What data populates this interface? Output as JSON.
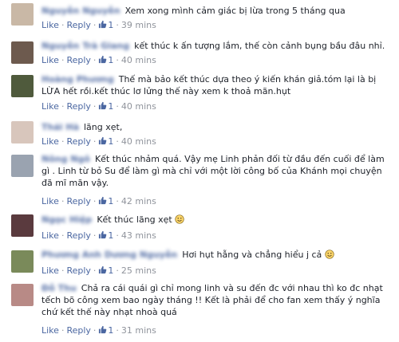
{
  "actions": {
    "like_label": "Like",
    "reply_label": "Reply",
    "separator": "·"
  },
  "comments": [
    {
      "name": "Nguyễn Nguyễn",
      "lines": [
        "Xem xong mình cảm giác bị lừa trong 5 tháng qua"
      ],
      "likes": "1",
      "time": "39 mins",
      "avatar_color": "#c9b8a6",
      "emoji": ""
    },
    {
      "name": "Nguyễn Trà Giang",
      "lines": [
        "kết thúc k ấn tượng lắm, thế còn cảnh bụng bầu đâu nhỉ."
      ],
      "likes": "1",
      "time": "40 mins",
      "avatar_color": "#6d5a4e",
      "emoji": ""
    },
    {
      "name": "Hoàng Phương",
      "lines": [
        "Thế mà bảo kết thúc dựa theo ý kiến khán giả.tóm lại là bị",
        "LỪA hết rồi.kết thúc lơ lửng thế này xem k thoả mãn.hụt"
      ],
      "likes": "1",
      "time": "40 mins",
      "avatar_color": "#4f5a3c",
      "emoji": ""
    },
    {
      "name": "Thái Hà",
      "lines": [
        "lãng xẹt,"
      ],
      "likes": "1",
      "time": "40 mins",
      "avatar_color": "#d8c6bc",
      "emoji": ""
    },
    {
      "name": "Nông Ngô",
      "lines": [
        "Kết thúc nhảm quá. Vậy mẹ Linh phản đối từ đầu đến cuối để làm",
        "gì . Linh từ bỏ Su để làm gì mà chỉ với một lời công bố của Khánh mọi chuyện",
        "đã mĩ mãn vậy."
      ],
      "likes": "1",
      "time": "42 mins",
      "avatar_color": "#9aa3b0",
      "emoji": ""
    },
    {
      "name": "Ngọc Hiệp",
      "lines": [
        "Kết thúc lãng xẹt"
      ],
      "likes": "1",
      "time": "43 mins",
      "avatar_color": "#5a3a3e",
      "emoji": "smile"
    },
    {
      "name": "Phương Anh Dương Nguyễn",
      "lines": [
        "Hơi hụt hẫng và chẳng hiểu j cả"
      ],
      "likes": "1",
      "time": "25 mins",
      "avatar_color": "#7a8a5a",
      "emoji": "smile"
    },
    {
      "name": "Đỗ Thu",
      "lines": [
        "Chả ra cái quái gì chỉ mong linh và su đến đc với nhau thì ko đc nhạt",
        "tếch bõ công xem bao ngày tháng !! Kết là phải để cho fan xem thấy ý nghĩa",
        "chứ kết thế này nhạt nhoà quá"
      ],
      "likes": "1",
      "time": "31 mins",
      "avatar_color": "#b88a86",
      "emoji": ""
    }
  ]
}
